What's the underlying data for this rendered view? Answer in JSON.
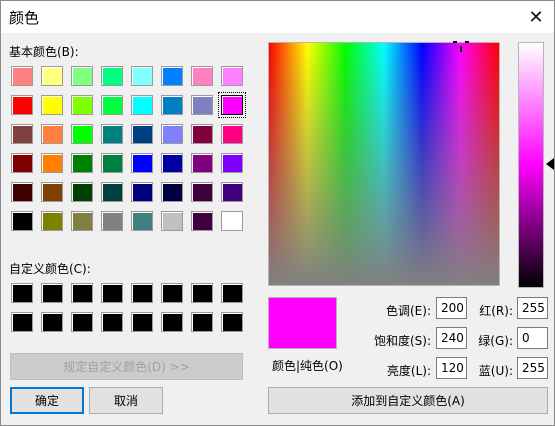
{
  "window": {
    "title": "颜色",
    "close_icon": "close-icon"
  },
  "basic_colors_label": "基本颜色(B):",
  "basic_colors": [
    [
      "#ff8080",
      "#ffff80",
      "#80ff80",
      "#00ff80",
      "#80ffff",
      "#0080ff",
      "#ff80c0",
      "#ff80ff"
    ],
    [
      "#ff0000",
      "#ffff00",
      "#80ff00",
      "#00ff40",
      "#00ffff",
      "#0080c0",
      "#8080c0",
      "#ff00ff"
    ],
    [
      "#804040",
      "#ff8040",
      "#00ff00",
      "#008080",
      "#004080",
      "#8080ff",
      "#800040",
      "#ff0080"
    ],
    [
      "#800000",
      "#ff8000",
      "#008000",
      "#008040",
      "#0000ff",
      "#0000a0",
      "#800080",
      "#8000ff"
    ],
    [
      "#400000",
      "#804000",
      "#004000",
      "#004040",
      "#000080",
      "#000040",
      "#400040",
      "#400080"
    ],
    [
      "#000000",
      "#808000",
      "#808040",
      "#808080",
      "#408080",
      "#c0c0c0",
      "#400040",
      "#ffffff"
    ]
  ],
  "selected_basic": "#ff00ff",
  "custom_colors_label": "自定义颜色(C):",
  "custom_colors": [
    [
      "#000000",
      "#000000",
      "#000000",
      "#000000",
      "#000000",
      "#000000",
      "#000000",
      "#000000"
    ],
    [
      "#000000",
      "#000000",
      "#000000",
      "#000000",
      "#000000",
      "#000000",
      "#000000",
      "#000000"
    ]
  ],
  "buttons": {
    "define_custom": "规定自定义颜色(D) >>",
    "ok": "确定",
    "cancel": "取消",
    "add_custom": "添加到自定义颜色(A)"
  },
  "preview_label": "颜色|纯色(O)",
  "fields": {
    "hue_label": "色调(E):",
    "hue": "200",
    "sat_label": "饱和度(S):",
    "sat": "240",
    "lum_label": "亮度(L):",
    "lum": "120",
    "red_label": "红(R):",
    "red": "255",
    "green_label": "绿(G):",
    "green": "0",
    "blue_label": "蓝(U):",
    "blue": "255"
  },
  "current_color": "#ff00ff"
}
